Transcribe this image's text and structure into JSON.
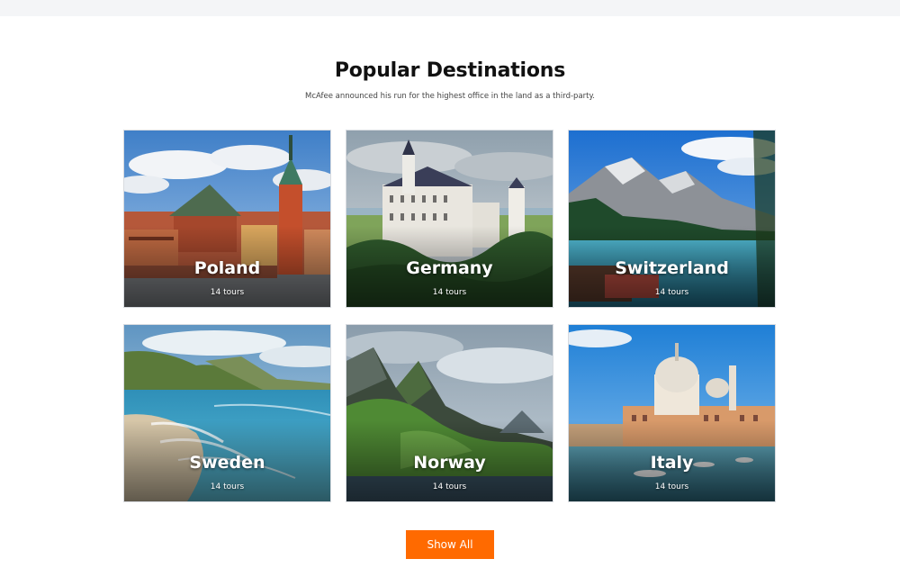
{
  "section": {
    "title": "Popular Destinations",
    "subtitle": "McAfee announced his run for the highest office in the land as a third-party."
  },
  "destinations": [
    {
      "name": "Poland",
      "tours": "14 tours",
      "image_icon": "warsaw-old-town-image"
    },
    {
      "name": "Germany",
      "tours": "14 tours",
      "image_icon": "castle-image"
    },
    {
      "name": "Switzerland",
      "tours": "14 tours",
      "image_icon": "mountain-lake-image"
    },
    {
      "name": "Sweden",
      "tours": "14 tours",
      "image_icon": "coastline-image"
    },
    {
      "name": "Norway",
      "tours": "14 tours",
      "image_icon": "fjord-mountain-image"
    },
    {
      "name": "Italy",
      "tours": "14 tours",
      "image_icon": "venice-image"
    }
  ],
  "show_all_label": "Show All",
  "colors": {
    "accent": "#ff6a00",
    "topbar": "#f4f5f7",
    "text": "#111111"
  }
}
